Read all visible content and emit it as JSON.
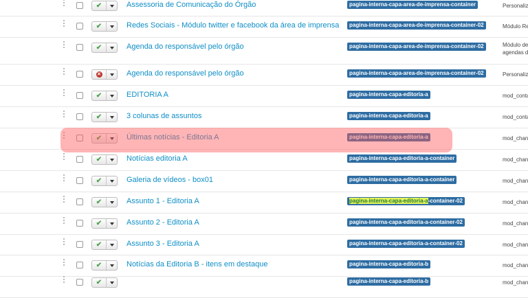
{
  "rows": [
    {
      "title": "Assessoria de Comunicação do Órgão",
      "position": "pagina-interna-capa-area-de-imprensa-container",
      "type": "Personaliz",
      "status": "published"
    },
    {
      "title": "Redes Sociais - Módulo twitter e facebook da área de imprensa",
      "position": "pagina-interna-capa-area-de-imprensa-container-02",
      "type": "Módulo Re",
      "status": "published"
    },
    {
      "title": "Agenda do responsável pelo órgão",
      "position": "pagina-interna-capa-area-de-imprensa-container-02",
      "type": "Módulo de",
      "type2": "agendas d",
      "status": "published"
    },
    {
      "title": "Agenda do responsável pelo órgão",
      "position": "pagina-interna-capa-area-de-imprensa-container-02",
      "type": "Personaliz",
      "status": "unpublished"
    },
    {
      "title": "EDITORIA A",
      "position": "pagina-interna-capa-editoria-a",
      "type": "mod_conta",
      "status": "published"
    },
    {
      "title": "3 colunas de assuntos",
      "position": "pagina-interna-capa-editoria-a",
      "type": "mod_conta",
      "status": "published"
    },
    {
      "title": "Últimas notícias - Editoria A",
      "position": "pagina-interna-capa-editoria-a",
      "type": "mod_chan",
      "status": "published"
    },
    {
      "title": "Notícias editoria A",
      "position": "pagina-interna-capa-editoria-a-container",
      "type": "mod_chan",
      "status": "published"
    },
    {
      "title": "Galeria de vídeos - box01",
      "position": "pagina-interna-capa-editoria-a-container",
      "type": "mod_chan",
      "status": "published"
    },
    {
      "title": "Assunto 1 - Editoria A",
      "position_selected": "pagina-interna-capa-editoria-a",
      "position": "-container-02",
      "type": "mod_chan",
      "status": "published"
    },
    {
      "title": "Assunto 2 - Editoria A",
      "position": "pagina-interna-capa-editoria-a-container-02",
      "type": "mod_chan",
      "status": "published"
    },
    {
      "title": "Assunto 3 - Editoria A",
      "position": "pagina-interna-capa-editoria-a-container-02",
      "type": "mod_chan",
      "status": "published"
    },
    {
      "title": "Notícias da Editoria B - itens em destaque",
      "position": "pagina-interna-capa-editoria-b",
      "type": "mod_chan",
      "status": "published"
    },
    {
      "title": "",
      "position": "pagina-interna-capa-editoria-b",
      "type": "mod_chan",
      "status": "published"
    }
  ],
  "icons": {
    "published": "check-icon",
    "unpublished": "cross-icon",
    "menu": "caret-down-icon",
    "drag": "drag-handle-icon"
  },
  "colors": {
    "link": "#0e8ec7",
    "badge": "#2d6ca2",
    "published": "#51a351",
    "unpublished": "#bd362f",
    "highlight": "#ff5a5a"
  }
}
